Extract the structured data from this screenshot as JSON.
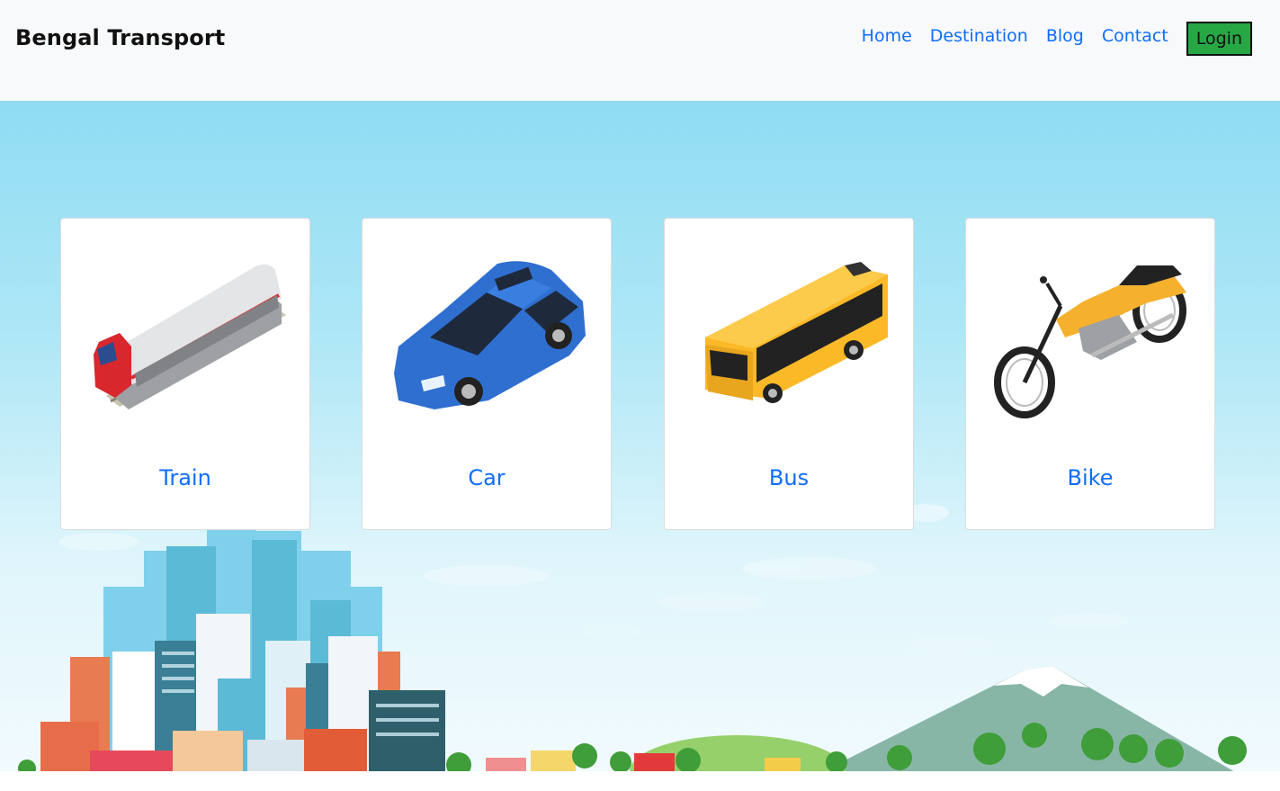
{
  "header": {
    "brand": "Bengal Transport",
    "nav": [
      "Home",
      "Destination",
      "Blog",
      "Contact"
    ],
    "login_label": "Login"
  },
  "cards": [
    {
      "title": "Train",
      "icon": "train-icon"
    },
    {
      "title": "Car",
      "icon": "car-icon"
    },
    {
      "title": "Bus",
      "icon": "bus-icon"
    },
    {
      "title": "Bike",
      "icon": "motorcycle-icon"
    }
  ],
  "colors": {
    "link": "#0d6efd",
    "login_bg": "#28a745",
    "navbar_bg": "#f8f9fa",
    "sky_top": "#8fdcf3",
    "sky_bottom": "#f2fbfe"
  }
}
